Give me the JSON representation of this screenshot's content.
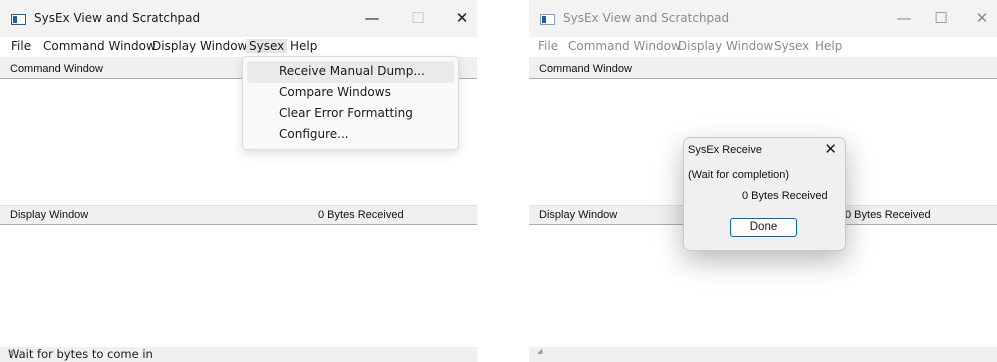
{
  "left": {
    "title": "SysEx View and Scratchpad",
    "minimize_glyph": "—",
    "maximize_glyph": "☐",
    "close_glyph": "✕",
    "menu": [
      "File",
      "Command Window",
      "Display Window",
      "Sysex",
      "Help"
    ],
    "active_menu": "Sysex",
    "dropdown": [
      "Receive Manual Dump...",
      "Compare Windows",
      "Clear Error Formatting",
      "Configure..."
    ],
    "command_header": "Command Window",
    "display_header": "Display Window",
    "bytes_received": "0  Bytes Received",
    "status": "Wait for bytes to come in"
  },
  "right": {
    "title": "SysEx View and Scratchpad",
    "menu": [
      "File",
      "Command Window",
      "Display Window",
      "Sysex",
      "Help"
    ],
    "command_header": "Command Window",
    "display_header": "Display Window",
    "bytes_received": "0  Bytes Received",
    "dialog": {
      "title": "SysEx Receive",
      "close_glyph": "✕",
      "message": "(Wait for completion)",
      "count": "0  Bytes Received",
      "button": "Done"
    }
  },
  "icons": [
    "app-icon",
    "minimize-icon",
    "maximize-icon",
    "close-icon",
    "resize-grip-icon"
  ],
  "colors": {
    "accent": "#0067c0",
    "app_icon": "#1e5fa8",
    "window_bg": "#f0f0f0"
  }
}
